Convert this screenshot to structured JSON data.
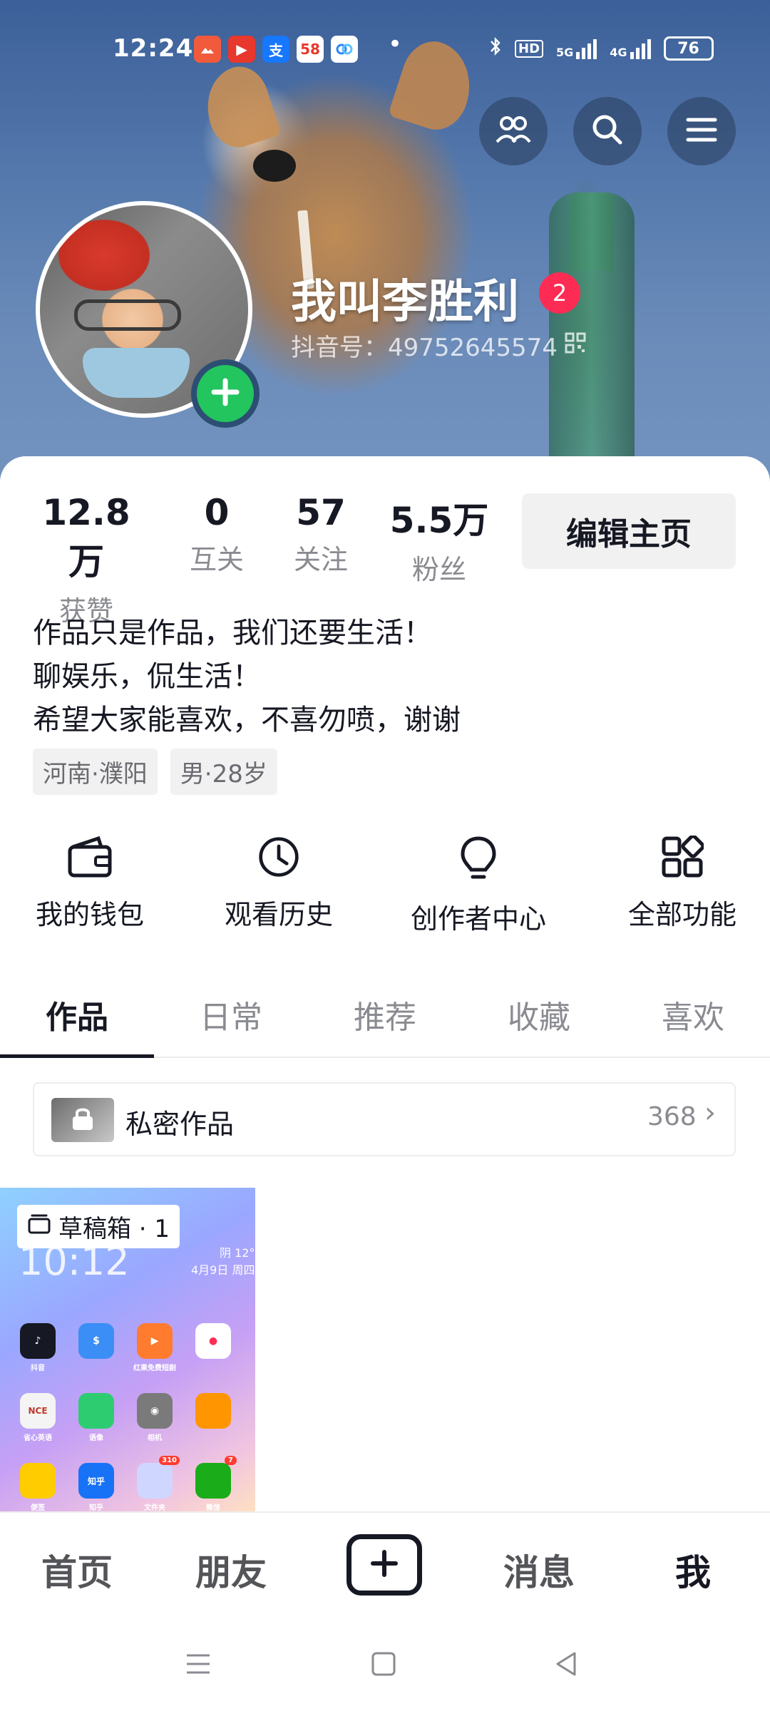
{
  "status_bar": {
    "time": "12:24",
    "apps": [
      {
        "icon": "photos-app-icon",
        "text": "",
        "color": "#f25a3c"
      },
      {
        "icon": "video-app-icon",
        "text": "▶",
        "color": "#e8372c"
      },
      {
        "icon": "alipay-app-icon",
        "text": "支",
        "color": "#1677ff"
      },
      {
        "icon": "58-app-icon",
        "text": "58",
        "color": "#ff6a00"
      },
      {
        "icon": "baidu-netdisk-app-icon",
        "text": "",
        "color": "#2f86f6"
      }
    ],
    "more_dot": "•",
    "network_5g": "5G",
    "network_4g": "4G",
    "battery": "76"
  },
  "profile": {
    "name": "我叫李胜利",
    "badge_count": "2",
    "douyin_id": "抖音号：49752645574"
  },
  "stats": [
    {
      "value": "12.8万",
      "label": "获赞"
    },
    {
      "value": "0",
      "label": "互关"
    },
    {
      "value": "57",
      "label": "关注"
    },
    {
      "value": "5.5万",
      "label": "粉丝"
    }
  ],
  "edit_button": "编辑主页",
  "bio": {
    "line1": "作品只是作品，我们还要生活！",
    "line2": "聊娱乐，侃生活！",
    "line3": "希望大家能喜欢，不喜勿喷，谢谢"
  },
  "tags": [
    "河南·濮阳",
    "男·28岁"
  ],
  "functions": [
    {
      "label": "我的钱包",
      "icon": "wallet-icon"
    },
    {
      "label": "观看历史",
      "icon": "clock-icon"
    },
    {
      "label": "创作者中心",
      "icon": "lightbulb-icon"
    },
    {
      "label": "全部功能",
      "icon": "grid-icon"
    }
  ],
  "tabs": [
    "作品",
    "日常",
    "推荐",
    "收藏",
    "喜欢"
  ],
  "active_tab": 0,
  "private_works": {
    "label": "私密作品",
    "count": "368",
    "arrow": "›"
  },
  "draft": {
    "label": "草稿箱 · 1",
    "time": "10:12",
    "weather": "阴 12°",
    "date": "4月9日 周四",
    "apps": [
      {
        "text": "♪",
        "caption": "抖音",
        "color": "#161823"
      },
      {
        "text": "$",
        "caption": "",
        "color": "#3a8ef5"
      },
      {
        "text": "▶",
        "caption": "红果免费短剧",
        "color": "#ff7b2e"
      },
      {
        "text": "●",
        "caption": "",
        "color": "#ff2d55"
      },
      {
        "text": "NCE",
        "caption": "省心英语",
        "color": "#f4f4f4"
      },
      {
        "text": "",
        "caption": "语像",
        "color": "#2ecc71"
      },
      {
        "text": "◉",
        "caption": "相机",
        "color": "#7a7a7a"
      },
      {
        "text": "",
        "caption": "",
        "color": "#ff9500"
      },
      {
        "text": "",
        "caption": "便签",
        "color": "#ffcc00"
      },
      {
        "text": "知乎",
        "caption": "知乎",
        "color": "#1772f6"
      },
      {
        "text": "",
        "caption": "文件夹",
        "color": "#cfd6ff",
        "badge": "310"
      },
      {
        "text": "",
        "caption": "微信",
        "color": "#1aad19",
        "badge": "7"
      }
    ]
  },
  "bottom_nav": {
    "home": "首页",
    "friends": "朋友",
    "messages": "消息",
    "me": "我"
  },
  "colors": {
    "accent_red": "#fe2c55",
    "add_green": "#22c55e",
    "text_primary": "#161823",
    "text_secondary": "#8a8b91"
  }
}
